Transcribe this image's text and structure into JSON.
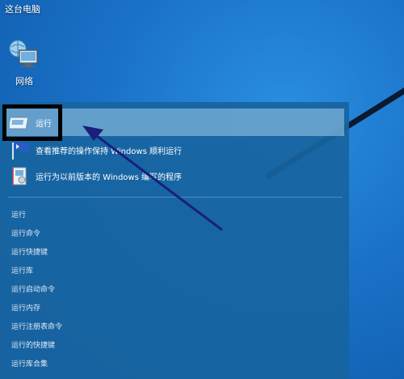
{
  "desktop": {
    "this_pc_label": "这台电脑",
    "network_label": "网络"
  },
  "search_results": [
    {
      "label": "运行",
      "icon": "run-icon"
    },
    {
      "label": "查看推荐的操作保持 Windows 顺利运行",
      "icon": "flag-icon"
    },
    {
      "label": "运行为以前版本的 Windows 编写的程序",
      "icon": "compat-icon"
    }
  ],
  "suggestions": [
    "运行",
    "运行命令",
    "运行快捷键",
    "运行库",
    "运行启动命令",
    "运行内存",
    "运行注册表命令",
    "运行的快捷键",
    "运行库合集"
  ],
  "colors": {
    "annotation": "#1a1f7a",
    "highlight_border": "#000000"
  }
}
